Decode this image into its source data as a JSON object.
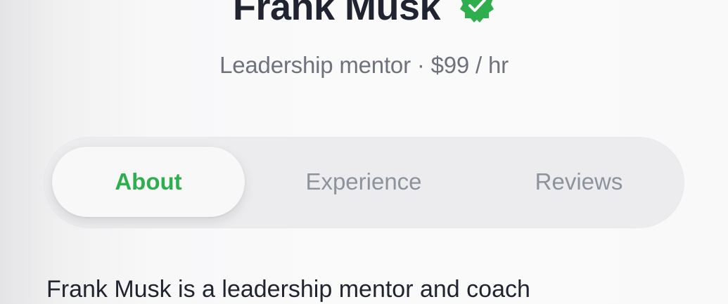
{
  "profile": {
    "name": "Frank Musk",
    "subtitle": "Leadership mentor · $99 / hr",
    "description": "Frank Musk is a leadership mentor and coach"
  },
  "tabs": [
    {
      "label": "About",
      "active": true
    },
    {
      "label": "Experience",
      "active": false
    },
    {
      "label": "Reviews",
      "active": false
    }
  ],
  "icons": {
    "verified": "verified-check-icon"
  },
  "colors": {
    "accent": "#2fae4e",
    "title": "#1f2430",
    "muted": "#6d727d",
    "tab_bg": "#ececef"
  }
}
